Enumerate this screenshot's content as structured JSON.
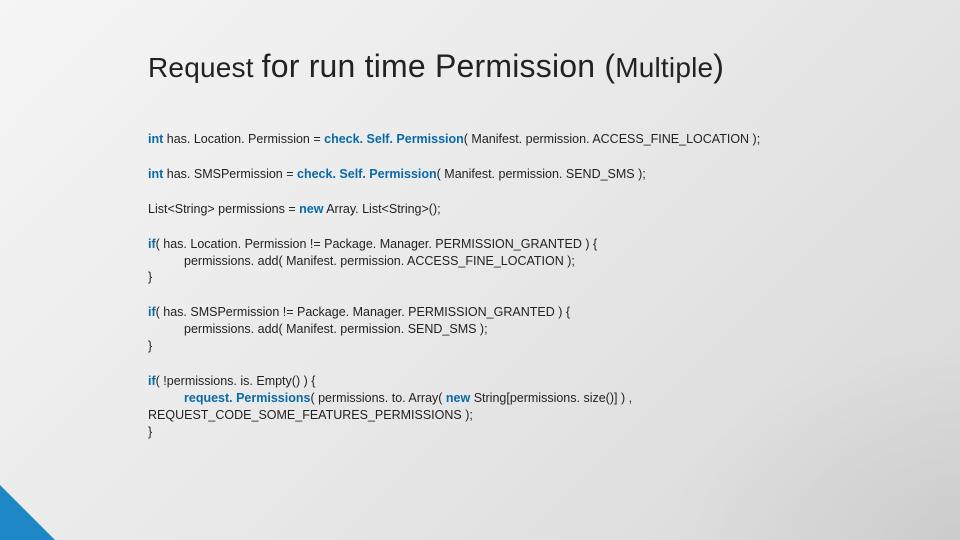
{
  "title": {
    "part1": "Request ",
    "part2": "for run time Permission (",
    "part3": "Multiple",
    "part4": ")"
  },
  "code": {
    "l1": {
      "kw": "int",
      "rest_a": "  has. Location. Permission = ",
      "fn": "check. Self. Permission",
      "rest_b": "( Manifest. permission. ACCESS_FINE_LOCATION );"
    },
    "l2": {
      "kw": "int",
      "rest_a": "  has. SMSPermission = ",
      "fn": "check. Self. Permission",
      "rest_b": "( Manifest. permission. SEND_SMS );"
    },
    "l3": {
      "a": "List<String> permissions = ",
      "kw": "new",
      "b": " Array. List<String>();"
    },
    "l4": {
      "kw": "if",
      "a": "( has. Location. Permission != Package. Manager. PERMISSION_GRANTED ) {"
    },
    "l5": "permissions. add( Manifest. permission. ACCESS_FINE_LOCATION );",
    "l6": "}",
    "l7": {
      "kw": "if",
      "a": "( has. SMSPermission != Package. Manager. PERMISSION_GRANTED ) {"
    },
    "l8": "permissions. add( Manifest. permission. SEND_SMS );",
    "l9": "}",
    "l10": {
      "kw": "if",
      "a": "( !permissions. is. Empty() ) {"
    },
    "l11": {
      "fn": "request. Permissions",
      "a": "( permissions. to. Array( ",
      "kw": "new",
      "b": " String[permissions. size()] ) ,"
    },
    "l12": "REQUEST_CODE_SOME_FEATURES_PERMISSIONS );",
    "l13": "}"
  }
}
